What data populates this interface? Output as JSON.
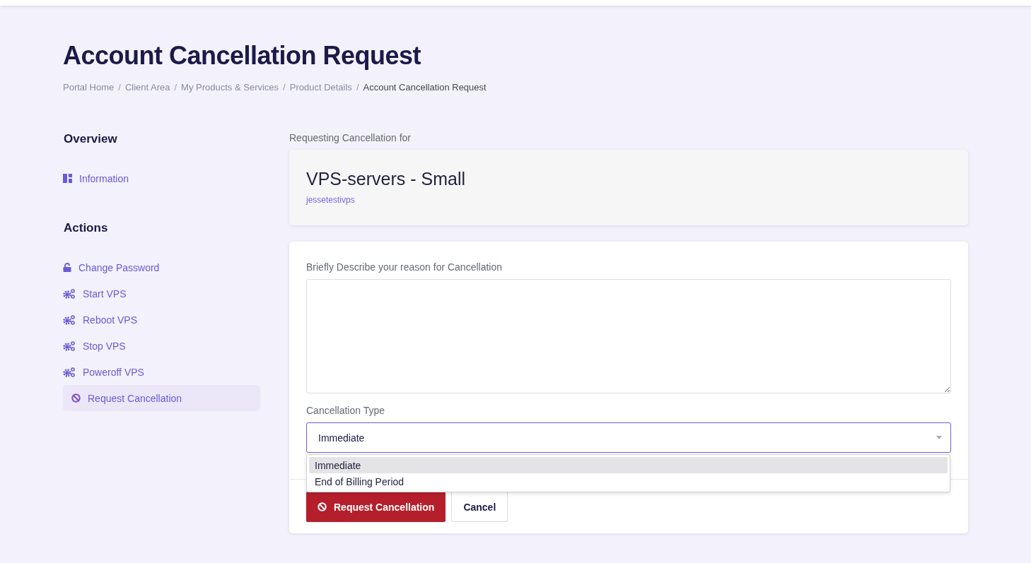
{
  "page": {
    "title": "Account Cancellation Request"
  },
  "breadcrumb_separator": "/",
  "breadcrumb": [
    {
      "label": "Portal Home",
      "current": false
    },
    {
      "label": "Client Area",
      "current": false
    },
    {
      "label": "My Products & Services",
      "current": false
    },
    {
      "label": "Product Details",
      "current": false
    },
    {
      "label": "Account Cancellation Request",
      "current": true
    }
  ],
  "sidebar": [
    {
      "heading": "Overview",
      "items": [
        {
          "label": "Information",
          "kind": "dashboard",
          "selected": false
        }
      ]
    },
    {
      "heading": "Actions",
      "items": [
        {
          "label": "Change Password",
          "kind": "lock",
          "selected": false
        },
        {
          "label": "Start VPS",
          "kind": "gears",
          "selected": false
        },
        {
          "label": "Reboot VPS",
          "kind": "gears",
          "selected": false
        },
        {
          "label": "Stop VPS",
          "kind": "gears",
          "selected": false
        },
        {
          "label": "Poweroff VPS",
          "kind": "gears",
          "selected": false
        },
        {
          "label": "Request Cancellation",
          "kind": "ban",
          "selected": true
        }
      ]
    }
  ],
  "product": {
    "caption": "Requesting Cancellation for",
    "name": "VPS-servers - Small",
    "hostname": "jessetestivps"
  },
  "form": {
    "reason_label": "Briefly Describe your reason for Cancellation",
    "type_label": "Cancellation Type",
    "type_value": "Immediate",
    "dropdown_open": true,
    "options": [
      {
        "label": "Immediate",
        "selected": true
      },
      {
        "label": "End of Billing Period",
        "selected": false
      }
    ],
    "submit": "Request Cancellation",
    "cancel": "Cancel"
  }
}
